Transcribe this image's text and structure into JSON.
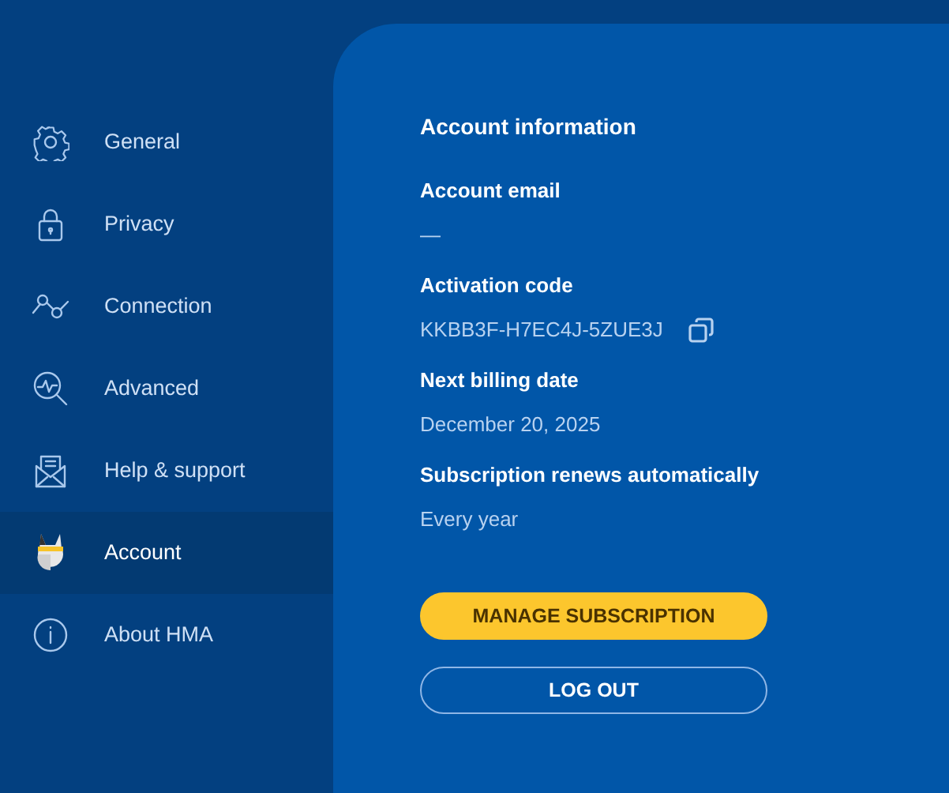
{
  "sidebar": {
    "items": [
      {
        "label": "General",
        "kind": "gear",
        "selected": false
      },
      {
        "label": "Privacy",
        "kind": "lock",
        "selected": false
      },
      {
        "label": "Connection",
        "kind": "nodes",
        "selected": false
      },
      {
        "label": "Advanced",
        "kind": "magnifier",
        "selected": false
      },
      {
        "label": "Help & support",
        "kind": "envelope",
        "selected": false
      },
      {
        "label": "Account",
        "kind": "avatar",
        "selected": true
      },
      {
        "label": "About HMA",
        "kind": "info",
        "selected": false
      }
    ]
  },
  "account": {
    "heading": "Account information",
    "fields": [
      {
        "label": "Account email",
        "value": "—"
      },
      {
        "label": "Activation code",
        "value": "KKBB3F-H7EC4J-5ZUE3J",
        "copyable": true
      },
      {
        "label": "Next billing date",
        "value": "December 20, 2025"
      },
      {
        "label": "Subscription renews automatically",
        "value": "Every year"
      }
    ],
    "buttons": [
      {
        "label": "MANAGE SUBSCRIPTION",
        "kind": "primary"
      },
      {
        "label": "LOG OUT",
        "kind": "outline"
      }
    ]
  }
}
